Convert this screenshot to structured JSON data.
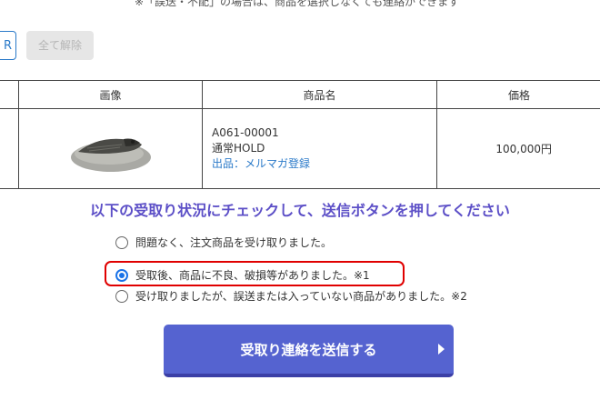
{
  "notice": "※「誤送・不配」の場合は、商品を選択しなくても連絡ができます",
  "buttons": {
    "partial_label": "R",
    "clear_all_label": "全て解除",
    "submit_label": "受取り連絡を送信する"
  },
  "table": {
    "headers": [
      "画像",
      "商品名",
      "価格"
    ],
    "rows": [
      {
        "image_icon": "trilobite-fossil",
        "code": "A061-00001",
        "status": "通常HOLD",
        "seller": "出品：メルマガ登録",
        "price": "100,000円"
      }
    ]
  },
  "instruction": "以下の受取り状況にチェックして、送信ボタンを押してください",
  "options": [
    {
      "label": "問題なく、注文商品を受け取りました。",
      "checked": false
    },
    {
      "label": "受取後、商品に不良、破損等がありました。※1",
      "checked": true
    },
    {
      "label": "受け取りましたが、誤送または入っていない商品がありました。※2",
      "checked": false
    }
  ],
  "colors": {
    "accent": "#5c4fc7",
    "button": "#5563d0",
    "highlight": "#e00000",
    "link": "#2b7ac9"
  }
}
